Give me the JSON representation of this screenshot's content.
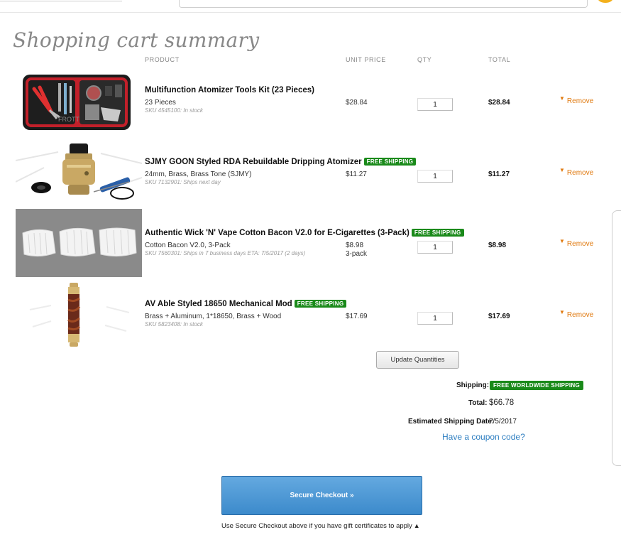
{
  "page": {
    "title": "Shopping cart summary"
  },
  "columns": {
    "product": "PRODUCT",
    "unit_price": "UNIT PRICE",
    "qty": "QTY",
    "total": "TOTAL"
  },
  "items": [
    {
      "name": "Multifunction Atomizer Tools Kit (23 Pieces)",
      "badge": "",
      "variant": "23 Pieces",
      "sku": "SKU 4545100: In stock",
      "unit_price": "$28.84",
      "unit_note": "",
      "qty": "1",
      "total": "$28.84",
      "remove": "Remove",
      "image": "tool-kit"
    },
    {
      "name": "SJMY GOON Styled RDA Rebuildable Dripping Atomizer",
      "badge": "FREE SHIPPING",
      "variant": "24mm, Brass, Brass Tone (SJMY)",
      "sku": "SKU 7132901: Ships next day",
      "unit_price": "$11.27",
      "unit_note": "",
      "qty": "1",
      "total": "$11.27",
      "remove": "Remove",
      "image": "rda-atomizer"
    },
    {
      "name": "Authentic Wick 'N' Vape Cotton Bacon V2.0 for E-Cigarettes (3-Pack)",
      "badge": "FREE SHIPPING",
      "variant": "Cotton Bacon V2.0, 3-Pack",
      "sku": "SKU 7560301: Ships in 7 business days ETA: 7/5/2017 (2 days)",
      "unit_price": "$8.98",
      "unit_note": "3-pack",
      "qty": "1",
      "total": "$8.98",
      "remove": "Remove",
      "image": "cotton-bacon"
    },
    {
      "name": "AV Able Styled 18650 Mechanical Mod",
      "badge": "FREE SHIPPING",
      "variant": "Brass + Aluminum, 1*18650, Brass + Wood",
      "sku": "SKU 5823408: In stock",
      "unit_price": "$17.69",
      "unit_note": "",
      "qty": "1",
      "total": "$17.69",
      "remove": "Remove",
      "image": "mech-mod"
    }
  ],
  "actions": {
    "update": "Update Quantities",
    "checkout": "Secure Checkout »"
  },
  "summary": {
    "shipping_label": "Shipping:",
    "shipping_value": "FREE WORLDWIDE SHIPPING",
    "total_label": "Total:",
    "total_value": "$66.78",
    "est_label": "Estimated Shipping Date:",
    "est_value": "7/5/2017",
    "coupon": "Have a coupon code?"
  },
  "footer": {
    "gift_note": "Use Secure Checkout above if you have gift certificates to apply",
    "gift_icon": "▲"
  },
  "colors": {
    "accent_orange": "#e07a10",
    "free_green": "#1a8a1a",
    "link_blue": "#2f7fc1",
    "checkout_blue": "#4a95d3"
  }
}
